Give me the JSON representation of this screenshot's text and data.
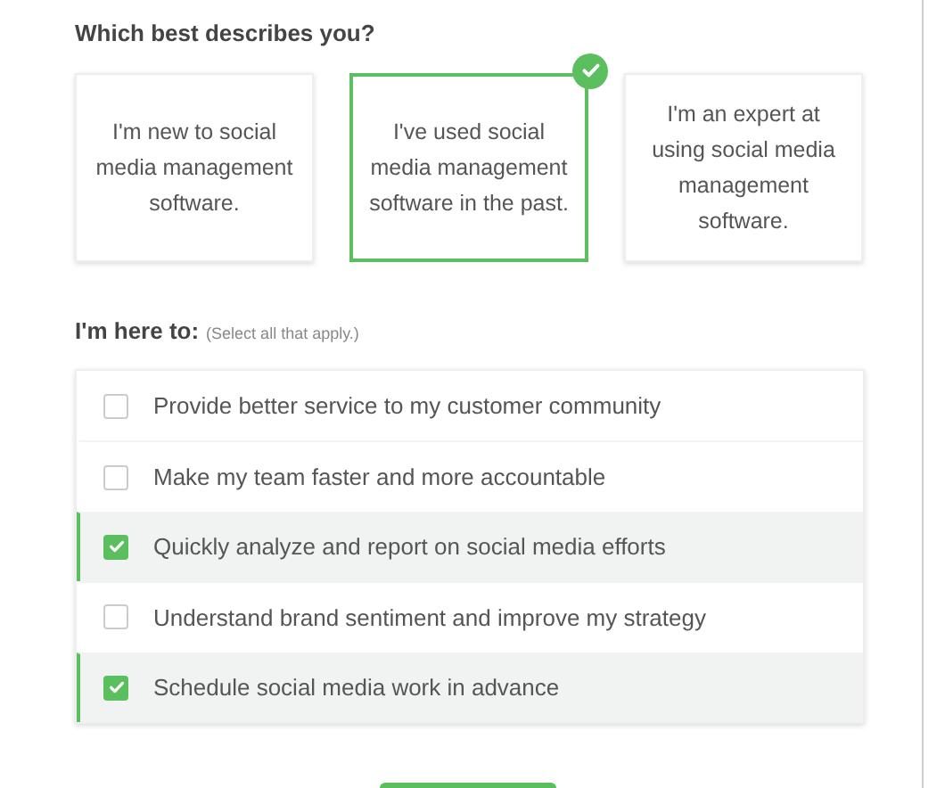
{
  "experience": {
    "title": "Which best describes you?",
    "options": [
      {
        "label": "I'm new to social media management software.",
        "selected": false
      },
      {
        "label": "I've used social media management software in the past.",
        "selected": true
      },
      {
        "label": "I'm an expert at using social media management software.",
        "selected": false
      }
    ]
  },
  "goals": {
    "title": "I'm here to:",
    "hint": "(Select all that apply.)",
    "items": [
      {
        "label": "Provide better service to my customer community",
        "checked": false
      },
      {
        "label": "Make my team faster and more accountable",
        "checked": false
      },
      {
        "label": "Quickly analyze and report on social media efforts",
        "checked": true
      },
      {
        "label": "Understand brand sentiment and improve my strategy",
        "checked": false
      },
      {
        "label": "Schedule social media work in advance",
        "checked": true
      }
    ]
  }
}
